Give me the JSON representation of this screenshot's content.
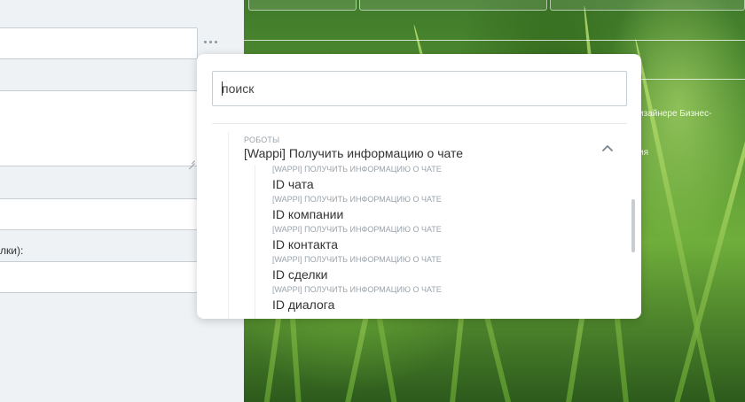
{
  "form": {
    "partial_label": "лки):"
  },
  "background": {
    "partial_text_1": "изайнере Бизнес-",
    "partial_text_2": "ия"
  },
  "dropdown": {
    "search": {
      "placeholder": "поиск",
      "value": ""
    },
    "group": {
      "category": "РОБОТЫ",
      "title": "[Wappi] Получить информацию о чате",
      "expanded": true,
      "items": [
        {
          "category": "[WAPPI] ПОЛУЧИТЬ ИНФОРМАЦИЮ О ЧАТЕ",
          "label": "ID чата"
        },
        {
          "category": "[WAPPI] ПОЛУЧИТЬ ИНФОРМАЦИЮ О ЧАТЕ",
          "label": "ID компании"
        },
        {
          "category": "[WAPPI] ПОЛУЧИТЬ ИНФОРМАЦИЮ О ЧАТЕ",
          "label": "ID контакта"
        },
        {
          "category": "[WAPPI] ПОЛУЧИТЬ ИНФОРМАЦИЮ О ЧАТЕ",
          "label": "ID сделки"
        },
        {
          "category": "[WAPPI] ПОЛУЧИТЬ ИНФОРМАЦИЮ О ЧАТЕ",
          "label": "ID диалога"
        }
      ]
    }
  },
  "colors": {
    "panel_bg": "#eef2f4",
    "field_border": "#c6cdd3",
    "muted_text": "#9aa3ab",
    "text": "#333333"
  }
}
